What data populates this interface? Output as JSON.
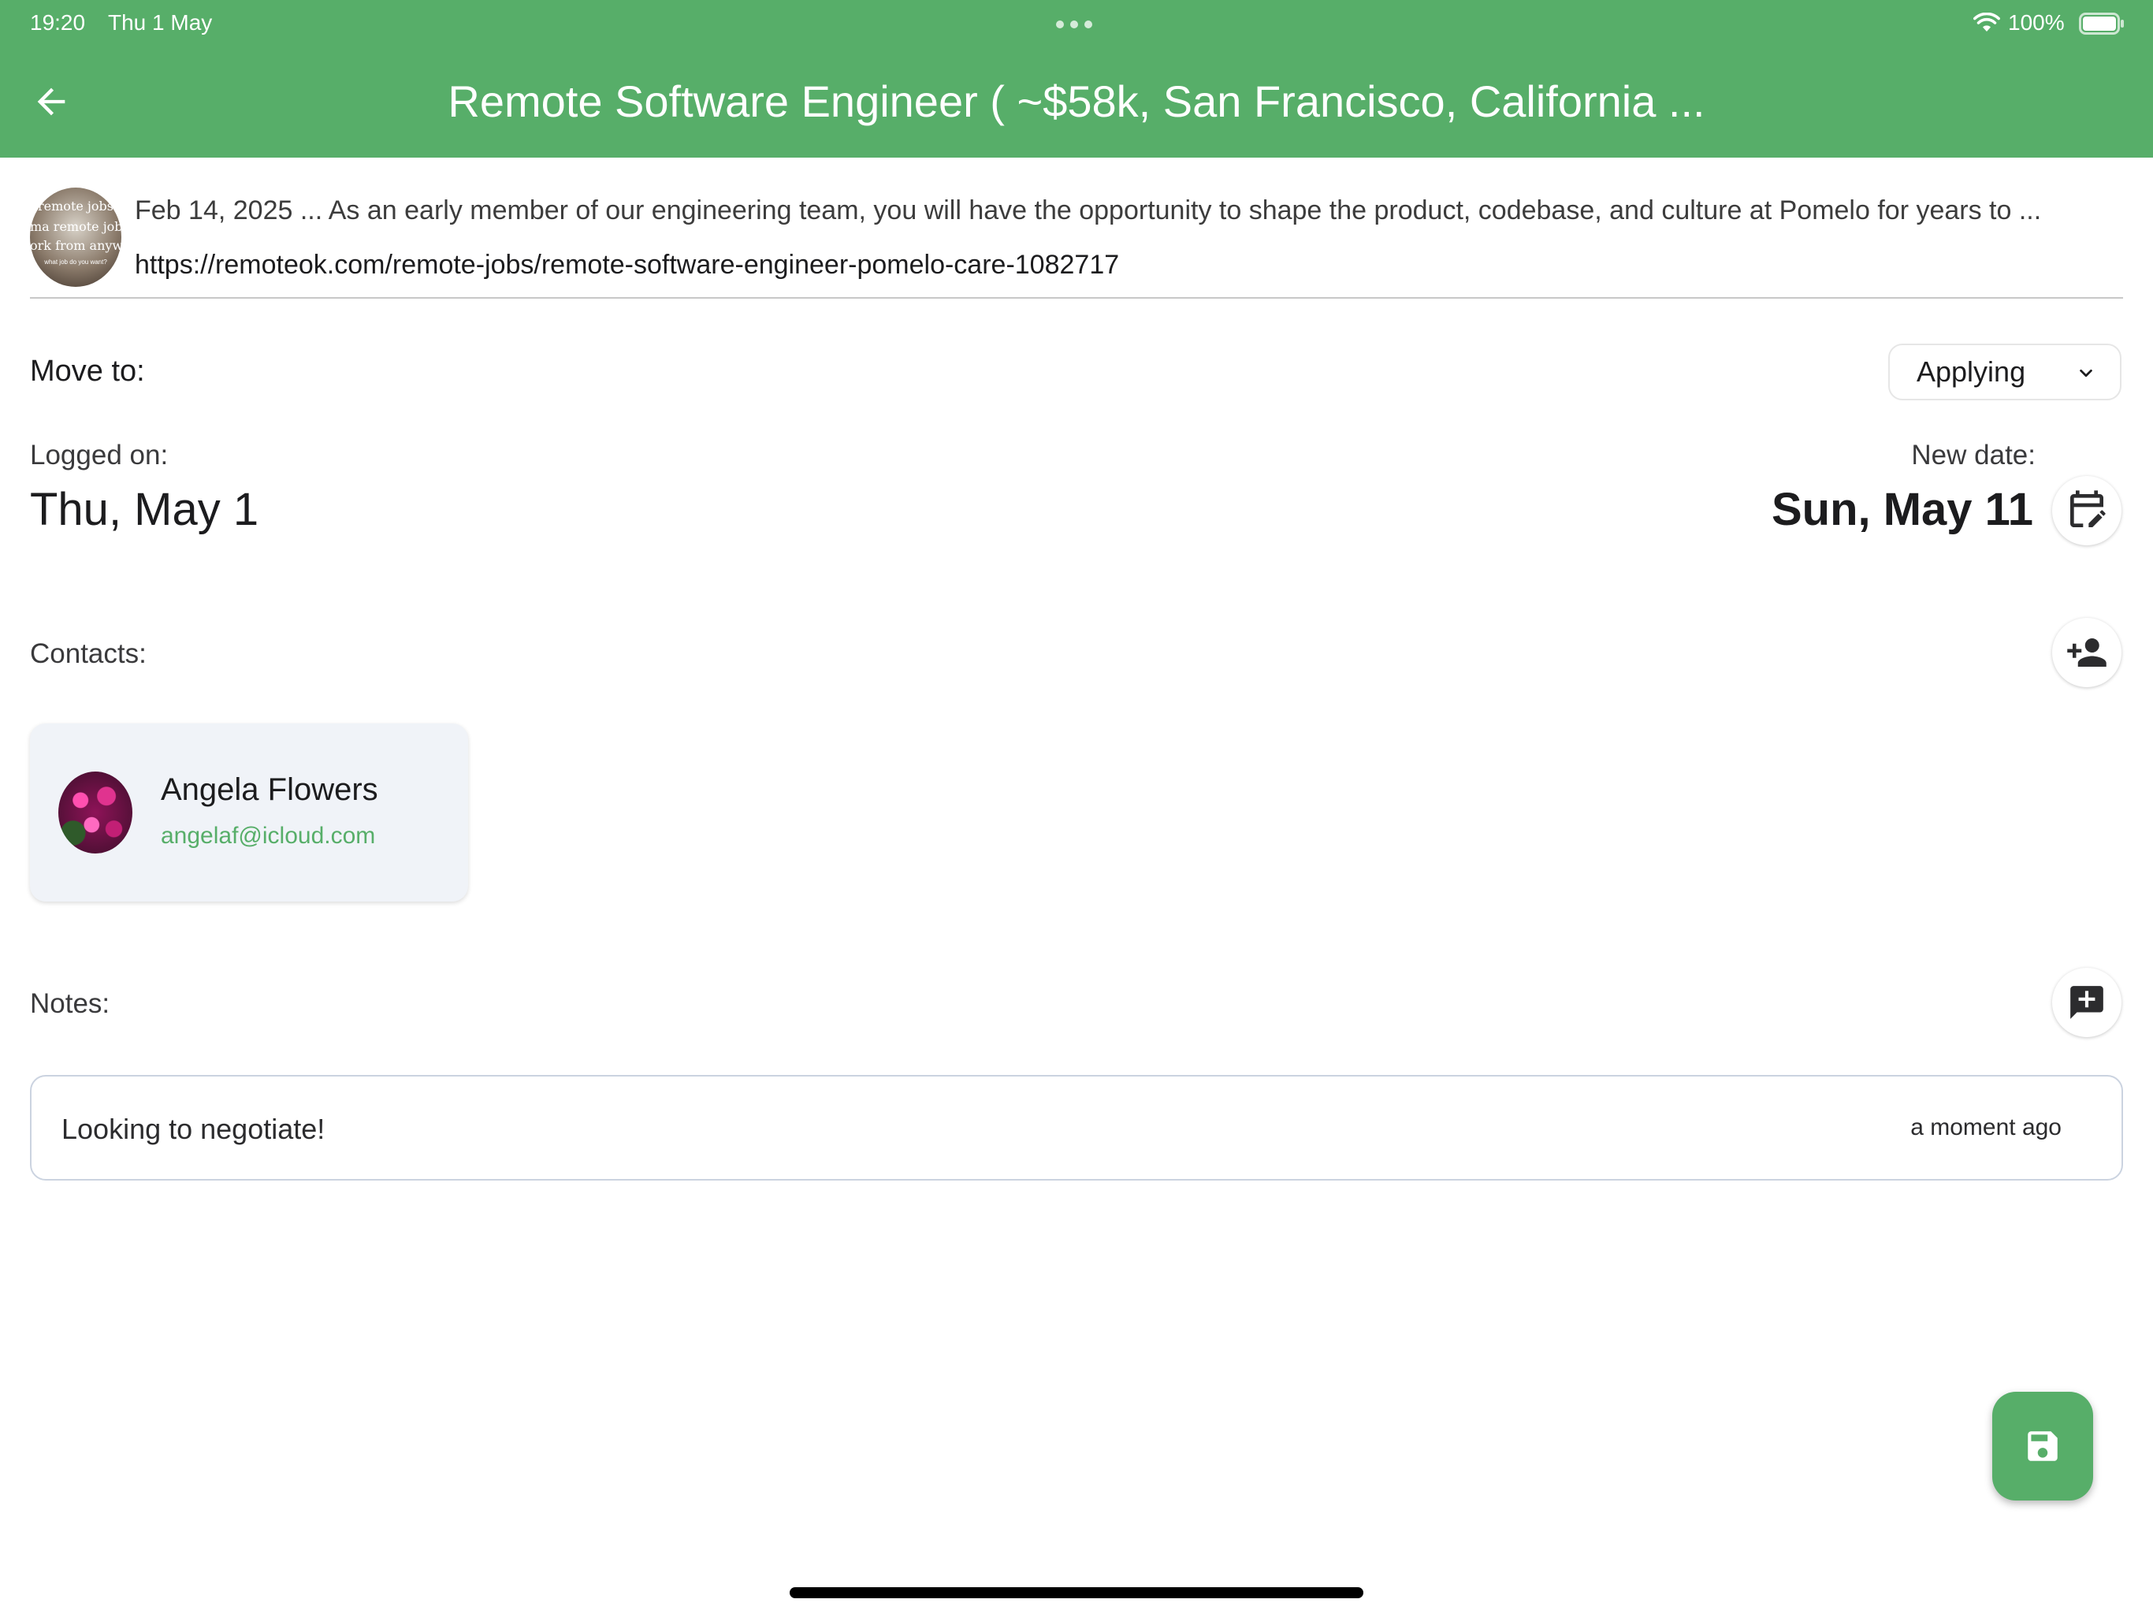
{
  "status_bar": {
    "time": "19:20",
    "date": "Thu 1 May",
    "battery": "100%"
  },
  "app_bar": {
    "title": "Remote Software Engineer ( ~$58k, San Francisco, California ..."
  },
  "job": {
    "thumbnail_text": [
      "remote jobs",
      "ma remote job",
      "ork from anywhe",
      "what job do you want?"
    ],
    "snippet": "Feb 14, 2025 ... As an early member of our engineering team, you will have the opportunity to shape the product, codebase, and culture at Pomelo for years to ...",
    "url": "https://remoteok.com/remote-jobs/remote-software-engineer-pomelo-care-1082717"
  },
  "move_to": {
    "label": "Move to:",
    "selected": "Applying"
  },
  "dates": {
    "logged_label": "Logged on:",
    "logged_value": "Thu, May 1",
    "new_label": "New date:",
    "new_value": "Sun, May 11"
  },
  "contacts": {
    "label": "Contacts:",
    "items": [
      {
        "name": "Angela Flowers",
        "email": "angelaf@icloud.com"
      }
    ]
  },
  "notes": {
    "label": "Notes:",
    "items": [
      {
        "text": "Looking to negotiate!",
        "time": "a moment ago"
      }
    ]
  },
  "icons": {
    "back": "arrow-left-icon",
    "calendar": "calendar-edit-icon",
    "add_contact": "person-add-icon",
    "add_note": "note-add-icon",
    "save": "save-icon"
  },
  "colors": {
    "primary": "#57ae69",
    "card_bg": "#f0f3f8",
    "note_border": "#cbd3e0"
  }
}
